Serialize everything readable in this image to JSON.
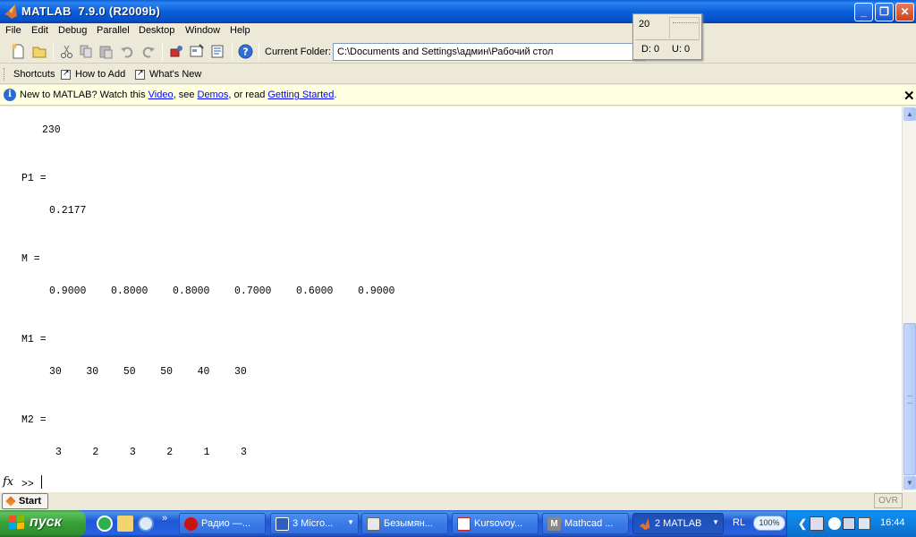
{
  "window": {
    "title": "MATLAB  7.9.0 (R2009b)"
  },
  "menu": [
    "File",
    "Edit",
    "Debug",
    "Parallel",
    "Desktop",
    "Window",
    "Help"
  ],
  "toolbar": {
    "folder_label": "Current Folder:",
    "folder_value": "C:\\Documents and Settings\\админ\\Рабочий стол"
  },
  "popup": {
    "value": "20",
    "d_label": "D: 0",
    "u_label": "U: 0"
  },
  "shortcuts": {
    "label": "Shortcuts",
    "items": [
      "How to Add",
      "What's New"
    ]
  },
  "infobar": {
    "text1": "New to MATLAB? Watch this ",
    "link_video": "Video",
    "text2": ", see ",
    "link_demos": "Demos",
    "text3": ", or read ",
    "link_started": "Getting Started",
    "text4": "."
  },
  "command_window": {
    "lines": [
      "230",
      "P1 =",
      "0.2177",
      "M =",
      "0.9000    0.8000    0.8000    0.7000    0.6000    0.9000",
      "M1 =",
      "30    30    50    50    40    30",
      "M2 =",
      "3     2     3     2     1     3"
    ],
    "fx_label": "fx",
    "prompt": ">>"
  },
  "statusbar": {
    "start_label": "Start",
    "ovr_label": "OVR"
  },
  "taskbar": {
    "start_label": "пуск",
    "quicklaunch_more": "»",
    "tasks": [
      {
        "label": "Радио —...",
        "icon_color": "#cc1111"
      },
      {
        "label": "3 Micro...",
        "icon_color": "#2d5fbf"
      },
      {
        "label": "Безымян...",
        "icon_color": "#e8e8e8"
      },
      {
        "label": "Kursovoy...",
        "icon_color": "#cc2222"
      },
      {
        "label": "Mathcad ...",
        "icon_color": "#888888"
      },
      {
        "label": "2 MATLAB",
        "icon_color": "#d9641f"
      }
    ],
    "lang": "RL",
    "zoom": "100%",
    "clock": "16:44"
  },
  "colors": {
    "titlebar": "#0b5fd9",
    "taskbar": "#2157d7",
    "start": "#38a338",
    "infobar": "#ffffe1",
    "link": "#0000ff"
  }
}
